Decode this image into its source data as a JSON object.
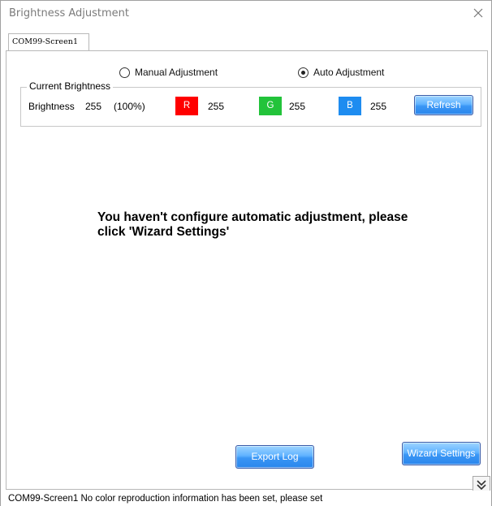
{
  "window": {
    "title": "Brightness Adjustment",
    "close_icon": "close-icon"
  },
  "tabs": [
    {
      "label": "COM99-Screen1",
      "selected": true
    }
  ],
  "mode": {
    "manual_label": "Manual Adjustment",
    "auto_label": "Auto Adjustment",
    "selected": "auto"
  },
  "current_brightness": {
    "legend": "Current Brightness",
    "brightness_label": "Brightness",
    "brightness_value": "255",
    "brightness_percent": "(100%)",
    "channels": [
      {
        "letter": "R",
        "value": "255",
        "color": "#ff0000",
        "text_color": "#ffffff"
      },
      {
        "letter": "G",
        "value": "255",
        "color": "#22c33a",
        "text_color": "#ffffff"
      },
      {
        "letter": "B",
        "value": "255",
        "color": "#1e8cf0",
        "text_color": "#ffffff"
      }
    ],
    "refresh_label": "Refresh"
  },
  "message": {
    "text": "You haven't configure automatic adjustment, please click 'Wizard Settings'"
  },
  "buttons": {
    "export_log": "Export Log",
    "wizard_settings": "Wizard Settings"
  },
  "status": {
    "text": "COM99-Screen1 No color reproduction information has been set, please set",
    "expand_icon": "double-chevron-down-icon"
  },
  "colors": {
    "button_blue": "#3a96f5",
    "border_gray": "#b8b8b8"
  }
}
